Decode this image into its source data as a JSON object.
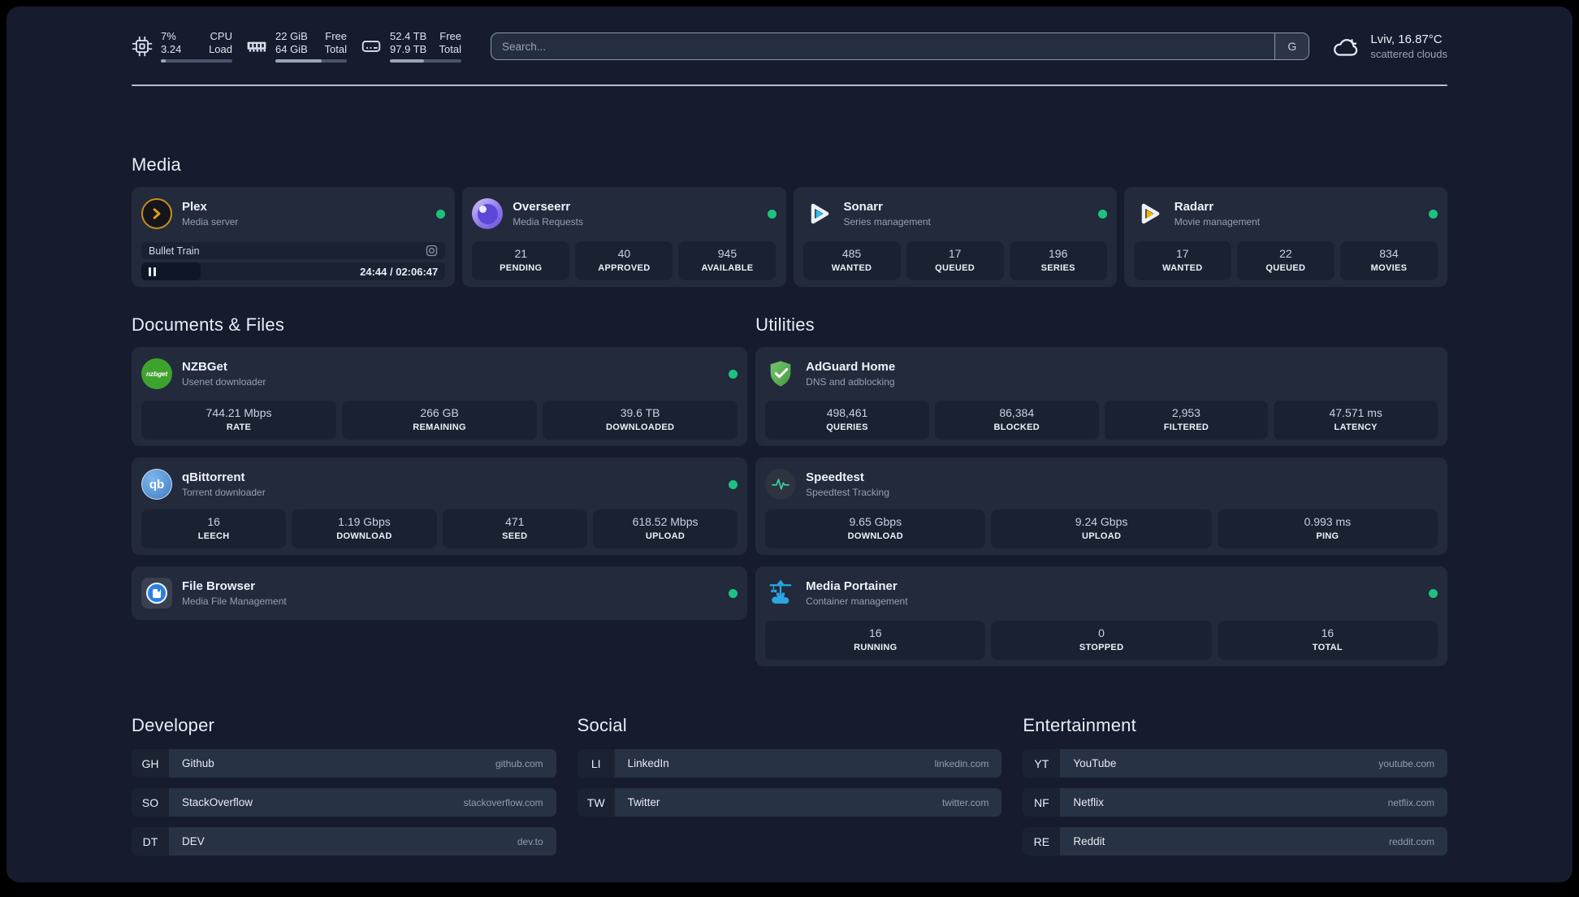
{
  "colors": {
    "online_dot": "#1ec27e",
    "accent_blue": "#33bef0",
    "accent_amber": "#f7b500",
    "adguard_green": "#5bab52",
    "portainer_blue": "#2aa7e0"
  },
  "topbar": {
    "cpu": {
      "value1": "7%",
      "value2": "3.24",
      "label1": "CPU",
      "label2": "Load",
      "progress_pct": 7
    },
    "ram": {
      "value1": "22 GiB",
      "value2": "64 GiB",
      "label1": "Free",
      "label2": "Total",
      "progress_pct": 65
    },
    "disk": {
      "value1": "52.4 TB",
      "value2": "97.9 TB",
      "label1": "Free",
      "label2": "Total",
      "progress_pct": 48
    },
    "search": {
      "placeholder": "Search...",
      "provider_button": "G"
    },
    "weather": {
      "summary": "Lviv, 16.87°C",
      "condition": "scattered clouds"
    }
  },
  "media": {
    "title": "Media",
    "plex": {
      "name": "Plex",
      "description": "Media server",
      "status": "online",
      "now_playing": {
        "title": "Bullet Train",
        "time_display": "24:44 / 02:06:47",
        "progress_pct": 19.5
      }
    },
    "overseerr": {
      "name": "Overseerr",
      "description": "Media Requests",
      "status": "online",
      "stats": [
        {
          "value": "21",
          "label": "PENDING"
        },
        {
          "value": "40",
          "label": "APPROVED"
        },
        {
          "value": "945",
          "label": "AVAILABLE"
        }
      ]
    },
    "sonarr": {
      "name": "Sonarr",
      "description": "Series management",
      "status": "online",
      "stats": [
        {
          "value": "485",
          "label": "WANTED"
        },
        {
          "value": "17",
          "label": "QUEUED"
        },
        {
          "value": "196",
          "label": "SERIES"
        }
      ]
    },
    "radarr": {
      "name": "Radarr",
      "description": "Movie management",
      "status": "online",
      "stats": [
        {
          "value": "17",
          "label": "WANTED"
        },
        {
          "value": "22",
          "label": "QUEUED"
        },
        {
          "value": "834",
          "label": "MOVIES"
        }
      ]
    }
  },
  "documents": {
    "title": "Documents & Files",
    "nzbget": {
      "name": "NZBGet",
      "description": "Usenet downloader",
      "status": "online",
      "icon_text": "nzbget",
      "stats": [
        {
          "value": "744.21 Mbps",
          "label": "RATE"
        },
        {
          "value": "266 GB",
          "label": "REMAINING"
        },
        {
          "value": "39.6 TB",
          "label": "DOWNLOADED"
        }
      ]
    },
    "qbittorrent": {
      "name": "qBittorrent",
      "description": "Torrent downloader",
      "status": "online",
      "icon_text": "qb",
      "stats": [
        {
          "value": "16",
          "label": "LEECH"
        },
        {
          "value": "1.19 Gbps",
          "label": "DOWNLOAD"
        },
        {
          "value": "471",
          "label": "SEED"
        },
        {
          "value": "618.52 Mbps",
          "label": "UPLOAD"
        }
      ]
    },
    "filebrowser": {
      "name": "File Browser",
      "description": "Media File Management",
      "status": "online"
    }
  },
  "utilities": {
    "title": "Utilities",
    "adguard": {
      "name": "AdGuard Home",
      "description": "DNS and adblocking",
      "stats": [
        {
          "value": "498,461",
          "label": "QUERIES"
        },
        {
          "value": "86,384",
          "label": "BLOCKED"
        },
        {
          "value": "2,953",
          "label": "FILTERED"
        },
        {
          "value": "47.571 ms",
          "label": "LATENCY"
        }
      ]
    },
    "speedtest": {
      "name": "Speedtest",
      "description": "Speedtest Tracking",
      "stats": [
        {
          "value": "9.65 Gbps",
          "label": "DOWNLOAD"
        },
        {
          "value": "9.24 Gbps",
          "label": "UPLOAD"
        },
        {
          "value": "0.993 ms",
          "label": "PING"
        }
      ]
    },
    "portainer": {
      "name": "Media Portainer",
      "description": "Container management",
      "status": "online",
      "stats": [
        {
          "value": "16",
          "label": "RUNNING"
        },
        {
          "value": "0",
          "label": "STOPPED"
        },
        {
          "value": "16",
          "label": "TOTAL"
        }
      ]
    }
  },
  "bookmarks": {
    "developer": {
      "title": "Developer",
      "links": [
        {
          "abbr": "GH",
          "name": "Github",
          "domain": "github.com"
        },
        {
          "abbr": "SO",
          "name": "StackOverflow",
          "domain": "stackoverflow.com"
        },
        {
          "abbr": "DT",
          "name": "DEV",
          "domain": "dev.to"
        }
      ]
    },
    "social": {
      "title": "Social",
      "links": [
        {
          "abbr": "LI",
          "name": "LinkedIn",
          "domain": "linkedin.com"
        },
        {
          "abbr": "TW",
          "name": "Twitter",
          "domain": "twitter.com"
        }
      ]
    },
    "entertainment": {
      "title": "Entertainment",
      "links": [
        {
          "abbr": "YT",
          "name": "YouTube",
          "domain": "youtube.com"
        },
        {
          "abbr": "NF",
          "name": "Netflix",
          "domain": "netflix.com"
        },
        {
          "abbr": "RE",
          "name": "Reddit",
          "domain": "reddit.com"
        }
      ]
    }
  }
}
